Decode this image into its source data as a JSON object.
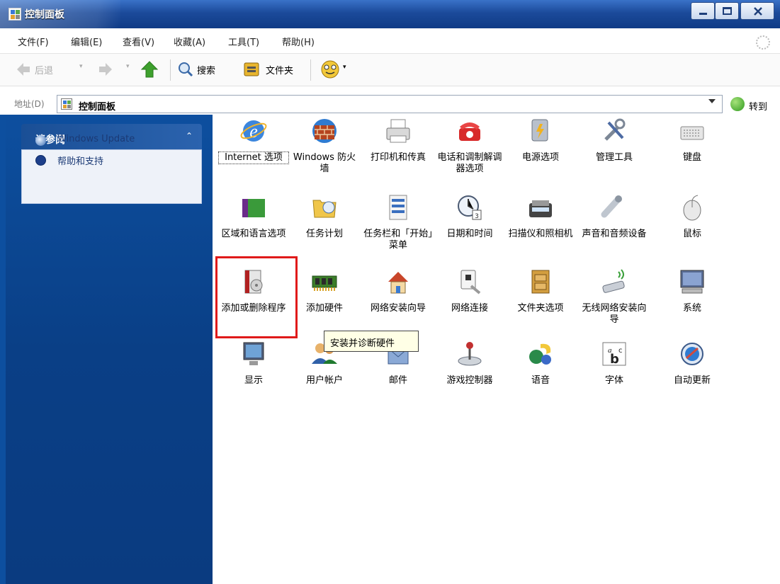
{
  "window": {
    "title": "控制面板"
  },
  "menu": [
    "文件(F)",
    "编辑(E)",
    "查看(V)",
    "收藏(A)",
    "工具(T)",
    "帮助(H)"
  ],
  "toolbar": {
    "back_label": "后退",
    "search_label": "搜索",
    "folders_label": "文件夹"
  },
  "address": {
    "label": "地址(D)",
    "value": "控制面板",
    "go_label": "转到"
  },
  "sidebar": {
    "title": "请参阅",
    "links": [
      {
        "label": "Windows Update",
        "icon": "windows-update-icon"
      },
      {
        "label": "帮助和支持",
        "icon": "help-icon"
      }
    ]
  },
  "items": [
    {
      "label": "Internet 选项",
      "icon": "internet-options-icon"
    },
    {
      "label": "Windows 防火墙",
      "icon": "firewall-icon"
    },
    {
      "label": "打印机和传真",
      "icon": "printer-icon"
    },
    {
      "label": "电话和调制解调器选项",
      "icon": "phone-modem-icon"
    },
    {
      "label": "电源选项",
      "icon": "power-options-icon"
    },
    {
      "label": "管理工具",
      "icon": "admin-tools-icon"
    },
    {
      "label": "键盘",
      "icon": "keyboard-icon"
    },
    {
      "label": "区域和语言选项",
      "icon": "region-language-icon"
    },
    {
      "label": "任务计划",
      "icon": "scheduled-tasks-icon"
    },
    {
      "label": "任务栏和「开始」菜单",
      "icon": "taskbar-start-icon"
    },
    {
      "label": "日期和时间",
      "icon": "date-time-icon"
    },
    {
      "label": "扫描仪和照相机",
      "icon": "scanner-camera-icon"
    },
    {
      "label": "声音和音频设备",
      "icon": "sound-audio-icon"
    },
    {
      "label": "鼠标",
      "icon": "mouse-icon"
    },
    {
      "label": "添加或删除程序",
      "icon": "add-remove-programs-icon"
    },
    {
      "label": "添加硬件",
      "icon": "add-hardware-icon"
    },
    {
      "label": "网络安装向导",
      "icon": "network-setup-icon"
    },
    {
      "label": "网络连接",
      "icon": "network-connections-icon"
    },
    {
      "label": "文件夹选项",
      "icon": "folder-options-icon"
    },
    {
      "label": "无线网络安装向导",
      "icon": "wireless-setup-icon"
    },
    {
      "label": "系统",
      "icon": "system-icon"
    },
    {
      "label": "显示",
      "icon": "display-icon"
    },
    {
      "label": "用户帐户",
      "icon": "user-accounts-icon"
    },
    {
      "label": "邮件",
      "icon": "mail-icon"
    },
    {
      "label": "游戏控制器",
      "icon": "game-controllers-icon"
    },
    {
      "label": "语音",
      "icon": "speech-icon"
    },
    {
      "label": "字体",
      "icon": "fonts-icon"
    },
    {
      "label": "自动更新",
      "icon": "automatic-updates-icon"
    }
  ],
  "tooltip": "安装并诊断硬件",
  "colors": {
    "titlebar": "#1b4a9a",
    "sidebar": "#0d4f9f",
    "highlight": "#e01a1a"
  }
}
